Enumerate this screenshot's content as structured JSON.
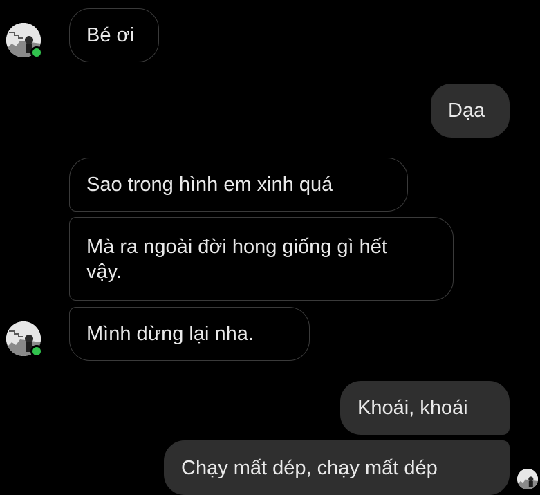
{
  "messages": [
    {
      "side": "incoming",
      "text": "Bé ơi"
    },
    {
      "side": "outgoing",
      "text": "Dạa"
    },
    {
      "side": "incoming",
      "text": "Sao trong hình em xinh quá"
    },
    {
      "side": "incoming",
      "text": "Mà ra ngoài đời hong giống gì hết vậy."
    },
    {
      "side": "incoming",
      "text": "Mình dừng lại nha."
    },
    {
      "side": "outgoing",
      "text": "Khoái, khoái"
    },
    {
      "side": "outgoing",
      "text": "Chạy mất dép, chạy mất dép"
    }
  ],
  "colors": {
    "background": "#000000",
    "incoming_border": "#3a3a3a",
    "outgoing_bubble": "#2f2f2f",
    "online_dot": "#31c24d",
    "text": "#e9e9e9"
  },
  "icons": {
    "contact_avatar": "profile-photo-avatar",
    "presence": "online-status-dot",
    "seen_avatar": "read-receipt-avatar"
  }
}
